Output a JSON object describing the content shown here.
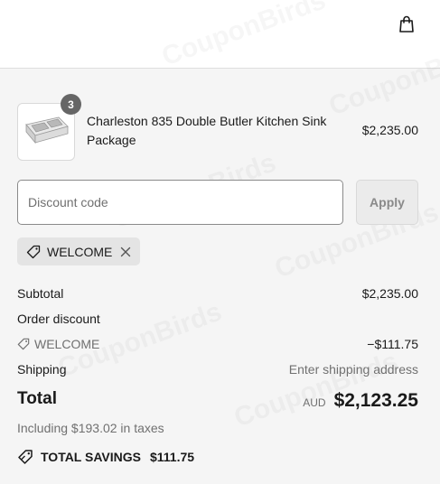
{
  "header": {
    "cart_icon": "shopping-bag-icon"
  },
  "line_item": {
    "quantity": "3",
    "name": "Charleston 835 Double Butler Kitchen Sink Package",
    "price": "$2,235.00",
    "image_icon": "double-sink-image"
  },
  "discount": {
    "placeholder": "Discount code",
    "apply_label": "Apply"
  },
  "applied_code": {
    "code": "WELCOME",
    "tag_icon": "tag-icon",
    "remove_icon": "close-icon"
  },
  "summary": {
    "subtotal_label": "Subtotal",
    "subtotal_value": "$2,235.00",
    "order_discount_label": "Order discount",
    "discount_code": "WELCOME",
    "discount_value": "−$111.75",
    "shipping_label": "Shipping",
    "shipping_value": "Enter shipping address",
    "total_label": "Total",
    "currency": "AUD",
    "total_value": "$2,123.25",
    "taxes_note": "Including $193.02 in taxes",
    "savings_label": "TOTAL SAVINGS",
    "savings_value": "$111.75"
  },
  "watermark_text": "CouponBirds",
  "colors": {
    "text": "#1a1a1a",
    "muted": "#707070",
    "background": "#f5f5f5",
    "badge": "#666666"
  }
}
